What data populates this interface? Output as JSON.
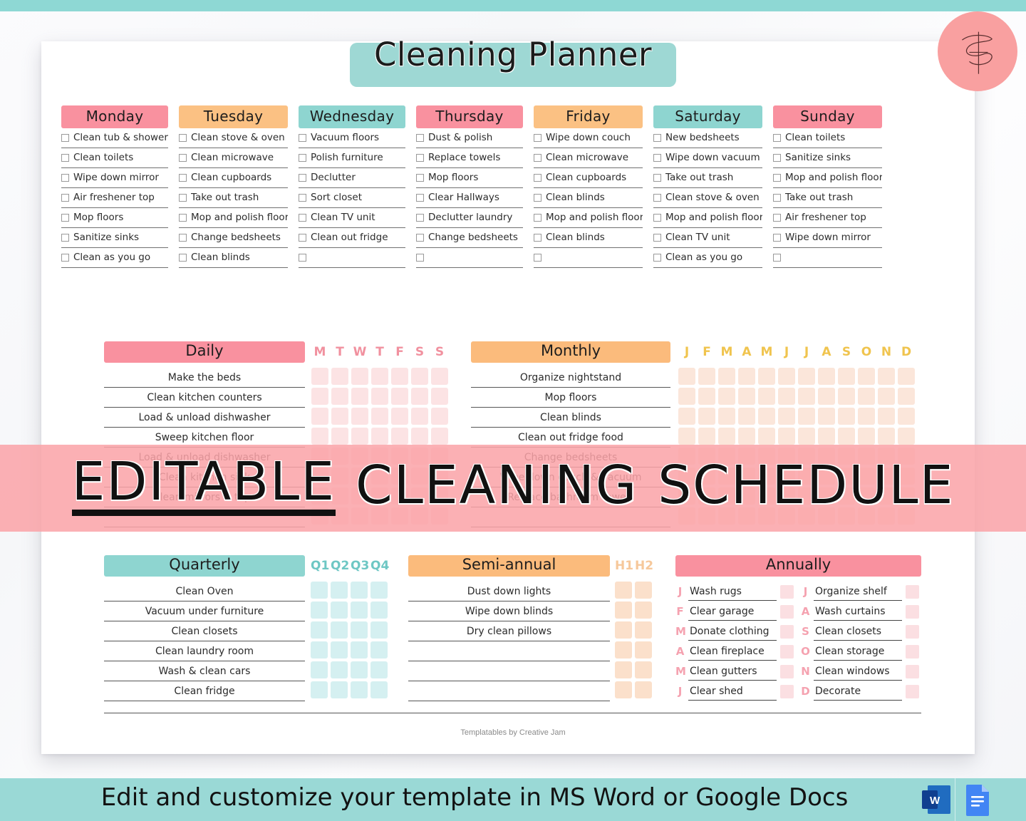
{
  "brand": {
    "logo_icon": "script-f-logo-icon",
    "accent_pink": "#f9a0a0",
    "accent_teal": "#8ed8d4"
  },
  "page": {
    "title": "Cleaning Planner",
    "credit": "Templatables by Creative Jam"
  },
  "week": {
    "days": [
      {
        "name": "Monday",
        "color": "#f9919f",
        "tasks": [
          "Clean tub & shower",
          "Clean toilets",
          "Wipe down mirror",
          "Air freshener top",
          "Mop floors",
          "Sanitize sinks",
          "Clean as you go"
        ]
      },
      {
        "name": "Tuesday",
        "color": "#fbc183",
        "tasks": [
          "Clean stove & oven",
          "Clean microwave",
          "Clean cupboards",
          "Take out trash",
          "Mop and polish floor",
          "Change bedsheets",
          "Clean blinds"
        ]
      },
      {
        "name": "Wednesday",
        "color": "#8ed5d0",
        "tasks": [
          "Vacuum floors",
          "Polish furniture",
          "Declutter",
          "Sort closet",
          "Clean TV unit",
          "Clean out fridge",
          ""
        ]
      },
      {
        "name": "Thursday",
        "color": "#f9919f",
        "tasks": [
          "Dust & polish",
          "Replace towels",
          "Mop floors",
          "Clear Hallways",
          "Declutter laundry",
          "Change bedsheets",
          ""
        ]
      },
      {
        "name": "Friday",
        "color": "#fbc183",
        "tasks": [
          "Wipe down couch",
          "Clean microwave",
          "Clean cupboards",
          "Clean blinds",
          "Mop and polish floor",
          "Clean blinds",
          ""
        ]
      },
      {
        "name": "Saturday",
        "color": "#8ed5d0",
        "tasks": [
          "New bedsheets",
          "Wipe down vacuum",
          "Take out trash",
          "Clean stove & oven",
          "Mop and polish floor",
          "Clean TV unit",
          "Clean as you go"
        ]
      },
      {
        "name": "Sunday",
        "color": "#f9919f",
        "tasks": [
          "Clean toilets",
          "Sanitize sinks",
          "Mop and polish floor",
          "Take out trash",
          "Air freshener top",
          "Wipe down mirror",
          ""
        ]
      }
    ]
  },
  "daily": {
    "title": "Daily",
    "header_color": "#f9919f",
    "columns": [
      "M",
      "T",
      "W",
      "T",
      "F",
      "S",
      "S"
    ],
    "column_label_color": "#f1919f",
    "cell_color": "#fce3e4",
    "items": [
      "Make the beds",
      "Clean kitchen counters",
      "Load & unload dishwasher",
      "Sweep kitchen floor",
      "Load & unload dishwasher",
      "Clean kitchen sink",
      "Clean mirrors & taps",
      ""
    ]
  },
  "monthly": {
    "title": "Monthly",
    "header_color": "#fbbb7c",
    "columns": [
      "J",
      "F",
      "M",
      "A",
      "M",
      "J",
      "J",
      "A",
      "S",
      "O",
      "N",
      "D"
    ],
    "column_label_color": "#f0c44e",
    "cell_color": "#fbe6da",
    "items": [
      "Organize nightstand",
      "Mop floors",
      "Clean blinds",
      "Clean out fridge food",
      "Change bedsheets",
      "Wipe down couch & vacuum",
      "Replace bathroom towels",
      ""
    ]
  },
  "quarterly": {
    "title": "Quarterly",
    "header_color": "#8ed5d0",
    "columns": [
      "Q1",
      "Q2",
      "Q3",
      "Q4"
    ],
    "column_label_color": "#6ec7c4",
    "cell_color": "#d5f0f1",
    "items": [
      "Clean Oven",
      "Vacuum under furniture",
      "Clean closets",
      "Clean laundry room",
      "Wash & clean cars",
      "Clean fridge"
    ]
  },
  "semi_annual": {
    "title": "Semi-annual",
    "header_color": "#fbbb7c",
    "columns": [
      "H1",
      "H2"
    ],
    "column_label_color": "#f6c89b",
    "cell_color": "#fbe0cb",
    "items": [
      "Dust down lights",
      "Wipe down blinds",
      "Dry clean pillows",
      "",
      "",
      ""
    ]
  },
  "annually": {
    "title": "Annually",
    "header_color": "#f9919f",
    "cell_color": "#fbdfe2",
    "left": [
      {
        "letter": "J",
        "task": "Wash rugs"
      },
      {
        "letter": "F",
        "task": "Clear garage"
      },
      {
        "letter": "M",
        "task": "Donate clothing"
      },
      {
        "letter": "A",
        "task": "Clean fireplace"
      },
      {
        "letter": "M",
        "task": "Clean gutters"
      },
      {
        "letter": "J",
        "task": "Clear shed"
      }
    ],
    "right": [
      {
        "letter": "J",
        "task": "Organize shelf"
      },
      {
        "letter": "A",
        "task": "Wash curtains"
      },
      {
        "letter": "S",
        "task": "Clean closets"
      },
      {
        "letter": "O",
        "task": "Clean storage"
      },
      {
        "letter": "N",
        "task": "Clean windows"
      },
      {
        "letter": "D",
        "task": "Decorate"
      }
    ]
  },
  "overlay": {
    "word1": "EDITABLE",
    "word2": "CLEANING",
    "word3": "SCHEDULE",
    "band_color": "#faa3a8"
  },
  "footer": {
    "text": "Edit and customize your template in MS Word or Google Docs",
    "band_color": "#9ad9d6",
    "icons": [
      {
        "name": "ms-word-icon",
        "letter": "W"
      },
      {
        "name": "google-docs-icon",
        "letter": ""
      }
    ]
  }
}
